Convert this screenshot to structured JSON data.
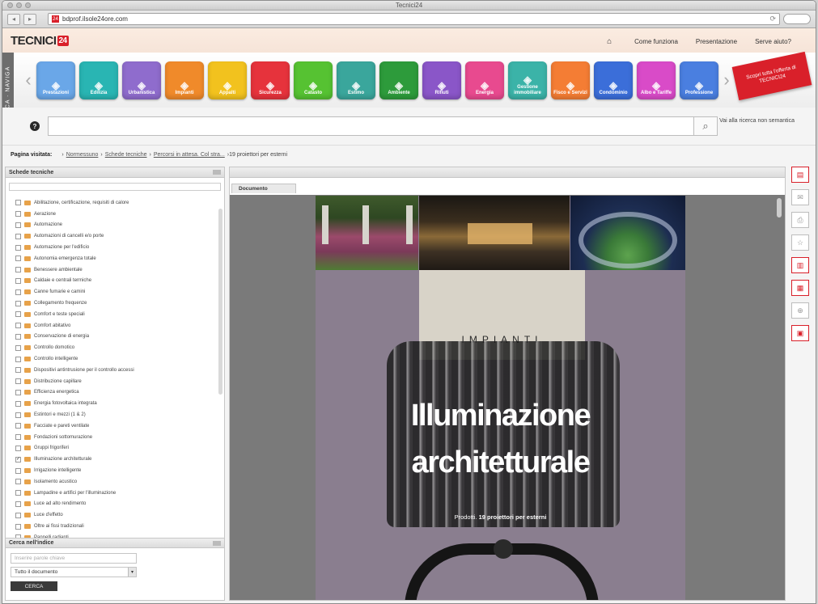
{
  "window": {
    "title": "Tecnici24"
  },
  "browser": {
    "url": "bdprof.ilsole24ore.com",
    "back_label": "◂",
    "forward_label": "▸"
  },
  "header": {
    "logo_text": "TECNICI",
    "logo_badge": "24",
    "nav": {
      "come_funziona": "Come funziona",
      "presentazione": "Presentazione",
      "serve_aiuto": "Serve aiuto?"
    }
  },
  "sidebar_tab": "RICERCA · NAVIGA",
  "tiles": [
    {
      "label": "Prestazioni",
      "color": "#6aa7e8",
      "icon": "drawing-icon"
    },
    {
      "label": "Edilizia",
      "color": "#29b5b3",
      "icon": "building-icon"
    },
    {
      "label": "Urbanistica",
      "color": "#8f6ccd",
      "icon": "city-icon"
    },
    {
      "label": "Impianti",
      "color": "#f08a2a",
      "icon": "plant-icon"
    },
    {
      "label": "Appalti",
      "color": "#f2c21e",
      "icon": "contract-icon"
    },
    {
      "label": "Sicurezza",
      "color": "#e6333c",
      "icon": "helmet-icon"
    },
    {
      "label": "Catasto",
      "color": "#56c232",
      "icon": "map-icon"
    },
    {
      "label": "Estimo",
      "color": "#3aa69c",
      "icon": "estimate-icon"
    },
    {
      "label": "Ambiente",
      "color": "#2d9b3b",
      "icon": "tree-icon"
    },
    {
      "label": "Rifiuti",
      "color": "#8a56c8",
      "icon": "bin-icon"
    },
    {
      "label": "Energia",
      "color": "#e84a8f",
      "icon": "energy-icon"
    },
    {
      "label": "Gestione immobiliare",
      "color": "#3bb3a8",
      "icon": "house-icon"
    },
    {
      "label": "Fisco e Servizi",
      "color": "#f47d34",
      "icon": "tax-icon"
    },
    {
      "label": "Condominio",
      "color": "#3b6ed9",
      "icon": "condo-icon"
    },
    {
      "label": "Albo e Tariffe",
      "color": "#d94bc8",
      "icon": "tariff-icon"
    },
    {
      "label": "Professione",
      "color": "#4a7fe0",
      "icon": "profession-icon"
    }
  ],
  "promo": {
    "text": "Scopri tutta l'offerta di TECNICI24"
  },
  "search": {
    "placeholder": "",
    "hint": "Vai alla ricerca non semantica"
  },
  "breadcrumb": {
    "label": "Pagina visitata:",
    "crumbs": [
      "Normessuno",
      "Schede tecniche",
      "Percorsi in attesa. Col stra..."
    ],
    "current": "19 proiettori per esterni"
  },
  "left_panel": {
    "title": "Schede tecniche",
    "items": [
      {
        "label": "Abilitazione, certificazione, requisiti di calore",
        "checked": ""
      },
      {
        "label": "Aerazione",
        "checked": ""
      },
      {
        "label": "Automazione",
        "checked": ""
      },
      {
        "label": "Automazioni di cancelli e/o porte",
        "checked": ""
      },
      {
        "label": "Automazione per l'edificio",
        "checked": ""
      },
      {
        "label": "Autonomia emergenza totale",
        "checked": ""
      },
      {
        "label": "Benessere ambientale",
        "checked": ""
      },
      {
        "label": "Caldaie e centrali termiche",
        "checked": ""
      },
      {
        "label": "Canne fumarie e camini",
        "checked": ""
      },
      {
        "label": "Collegamento frequenze",
        "checked": ""
      },
      {
        "label": "Comfort e teste speciali",
        "checked": ""
      },
      {
        "label": "Comfort abitativo",
        "checked": ""
      },
      {
        "label": "Conservazione di energia",
        "checked": ""
      },
      {
        "label": "Controllo domotico",
        "checked": ""
      },
      {
        "label": "Controllo intelligente",
        "checked": ""
      },
      {
        "label": "Dispositivi antintrusione per il controllo accessi",
        "checked": ""
      },
      {
        "label": "Distribuzione capillare",
        "checked": ""
      },
      {
        "label": "Efficienza energetica",
        "checked": ""
      },
      {
        "label": "Energia fotovoltaica integrata",
        "checked": ""
      },
      {
        "label": "Estintori e mezzi (1 & 2)",
        "checked": ""
      },
      {
        "label": "Facciate e pareti ventilate",
        "checked": ""
      },
      {
        "label": "Fondazioni sottomurazione",
        "checked": ""
      },
      {
        "label": "Gruppi frigoriferi",
        "checked": ""
      },
      {
        "label": "Illuminazione architetturale",
        "checked": "✓"
      },
      {
        "label": "Irrigazione intelligente",
        "checked": ""
      },
      {
        "label": "Isolamento acustico",
        "checked": ""
      },
      {
        "label": "Lampadine e artifici per l'illuminazione",
        "checked": ""
      },
      {
        "label": "Luce ad alto rendimento",
        "checked": ""
      },
      {
        "label": "Luce d'effetto",
        "checked": ""
      },
      {
        "label": "Oltre ai fissi tradizionali",
        "checked": ""
      },
      {
        "label": "Pannelli radianti",
        "checked": ""
      }
    ]
  },
  "code_panel": {
    "title": "Cerca nell'indice",
    "input_placeholder": "Inserire parole chiave",
    "select_value": "Tutto il documento",
    "button_label": "CERCA"
  },
  "viewer": {
    "tab_label": "Documento",
    "document": {
      "section_label": "IMPIANTI",
      "title_line1": "Illuminazione",
      "title_line2": "architetturale",
      "subtitle_prefix": "Prodotti.",
      "subtitle_bold": "19 proiettori per esterni"
    }
  }
}
